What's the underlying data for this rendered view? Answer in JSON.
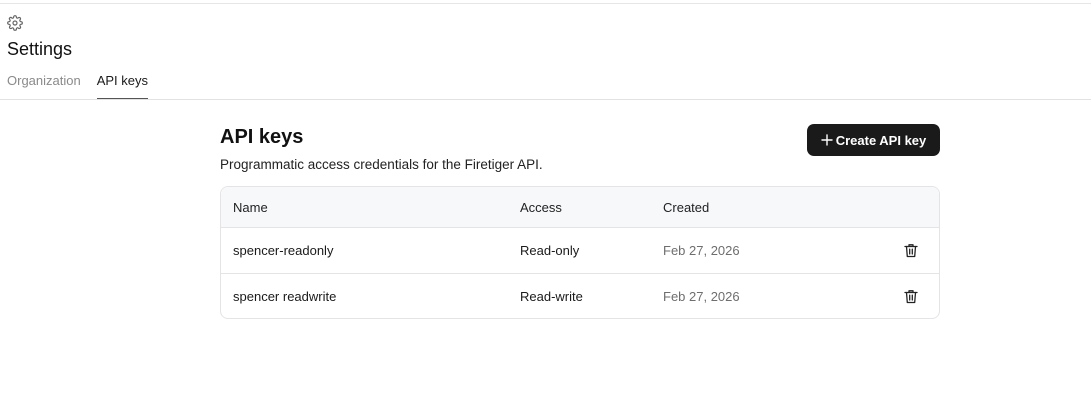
{
  "page": {
    "title": "Settings",
    "gear_icon": "gear-icon"
  },
  "tabs": [
    {
      "label": "Organization",
      "active": false
    },
    {
      "label": "API keys",
      "active": true
    }
  ],
  "section": {
    "title": "API keys",
    "description": "Programmatic access credentials for the Firetiger API.",
    "create_button_label": "Create API key",
    "create_button_icon": "plus-icon"
  },
  "table": {
    "columns": [
      "Name",
      "Access",
      "Created"
    ],
    "rows": [
      {
        "name": "spencer-readonly",
        "access": "Read-only",
        "created": "Feb 27, 2026",
        "action_icon": "trash-icon"
      },
      {
        "name": "spencer readwrite",
        "access": "Read-write",
        "created": "Feb 27, 2026",
        "action_icon": "trash-icon"
      }
    ]
  },
  "colors": {
    "primary_button_bg": "#1a1a1a",
    "table_header_bg": "#f7f8fa",
    "border": "#e4e4e7"
  }
}
